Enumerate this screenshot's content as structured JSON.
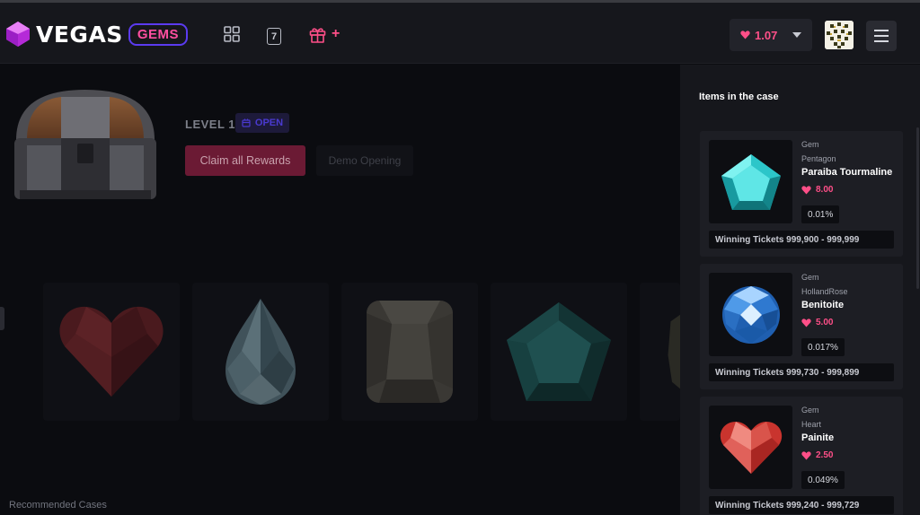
{
  "header": {
    "logo_text": "VEGAS",
    "logo_badge": "GEMS",
    "gift_plus": "+",
    "balance": "1.07",
    "nav_seven": "7"
  },
  "colors": {
    "accent_pink": "#ff4f88",
    "badge_border": "#5b3bf0",
    "claim_bg": "#6b1a34"
  },
  "case": {
    "level": "LEVEL 1",
    "open_label": "OPEN",
    "claim_label": "Claim all Rewards",
    "demo_label": "Demo Opening"
  },
  "carousel_gems": [
    "heart-ruby-icon",
    "pear-diamond-icon",
    "cushion-quartz-icon",
    "pentagon-tourmaline-icon",
    "partial-gem-icon"
  ],
  "recommended": "Recommended Cases",
  "sidebar": {
    "title": "Items in the case",
    "items": [
      {
        "type": "Gem",
        "shape": "Pentagon",
        "name": "Paraiba Tourmaline",
        "price": "8.00",
        "chance": "0.01%",
        "tickets": "Winning Tickets 999,900 - 999,999",
        "icon": "paraiba-tourmaline-icon"
      },
      {
        "type": "Gem",
        "shape": "HollandRose",
        "name": "Benitoite",
        "price": "5.00",
        "chance": "0.017%",
        "tickets": "Winning Tickets 999,730 - 999,899",
        "icon": "benitoite-icon"
      },
      {
        "type": "Gem",
        "shape": "Heart",
        "name": "Painite",
        "price": "2.50",
        "chance": "0.049%",
        "tickets": "Winning Tickets 999,240 - 999,729",
        "icon": "painite-icon"
      }
    ]
  }
}
